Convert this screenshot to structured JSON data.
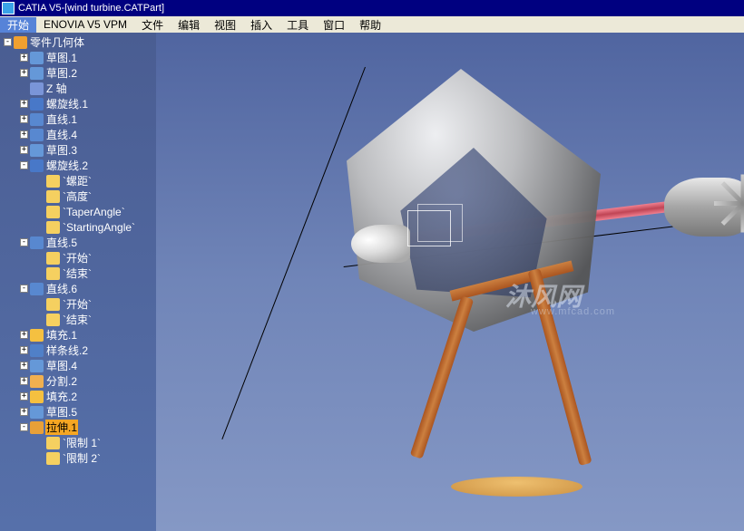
{
  "title": {
    "app": "CATIA V5",
    "sep": " - ",
    "doc": "[wind turbine.CATPart]"
  },
  "menu": {
    "items": [
      "开始",
      "ENOVIA V5 VPM",
      "文件",
      "编辑",
      "视图",
      "插入",
      "工具",
      "窗口",
      "帮助"
    ]
  },
  "tree": [
    {
      "d": 0,
      "exp": "-",
      "ico": "icon-body",
      "lbl": "零件几何体",
      "hl": false
    },
    {
      "d": 1,
      "exp": "+",
      "ico": "icon-sketch",
      "lbl": "草图.1",
      "hl": false
    },
    {
      "d": 1,
      "exp": "+",
      "ico": "icon-sketch",
      "lbl": "草图.2",
      "hl": false
    },
    {
      "d": 1,
      "exp": "",
      "ico": "icon-axis",
      "lbl": "Z 轴",
      "hl": false
    },
    {
      "d": 1,
      "exp": "+",
      "ico": "icon-helix",
      "lbl": "螺旋线.1",
      "hl": false
    },
    {
      "d": 1,
      "exp": "+",
      "ico": "icon-line",
      "lbl": "直线.1",
      "hl": false
    },
    {
      "d": 1,
      "exp": "+",
      "ico": "icon-line",
      "lbl": "直线.4",
      "hl": false
    },
    {
      "d": 1,
      "exp": "+",
      "ico": "icon-sketch",
      "lbl": "草图.3",
      "hl": false
    },
    {
      "d": 1,
      "exp": "-",
      "ico": "icon-helix",
      "lbl": "螺旋线.2",
      "hl": false
    },
    {
      "d": 2,
      "exp": "",
      "ico": "icon-param",
      "lbl": "`螺距`",
      "hl": false
    },
    {
      "d": 2,
      "exp": "",
      "ico": "icon-param",
      "lbl": "`高度`",
      "hl": false
    },
    {
      "d": 2,
      "exp": "",
      "ico": "icon-param",
      "lbl": "`TaperAngle`",
      "hl": false
    },
    {
      "d": 2,
      "exp": "",
      "ico": "icon-param",
      "lbl": "`StartingAngle`",
      "hl": false
    },
    {
      "d": 1,
      "exp": "-",
      "ico": "icon-line",
      "lbl": "直线.5",
      "hl": false
    },
    {
      "d": 2,
      "exp": "",
      "ico": "icon-param",
      "lbl": "`开始`",
      "hl": false
    },
    {
      "d": 2,
      "exp": "",
      "ico": "icon-param",
      "lbl": "`结束`",
      "hl": false
    },
    {
      "d": 1,
      "exp": "-",
      "ico": "icon-line",
      "lbl": "直线.6",
      "hl": false
    },
    {
      "d": 2,
      "exp": "",
      "ico": "icon-param",
      "lbl": "`开始`",
      "hl": false
    },
    {
      "d": 2,
      "exp": "",
      "ico": "icon-param",
      "lbl": "`结束`",
      "hl": false
    },
    {
      "d": 1,
      "exp": "+",
      "ico": "icon-fill",
      "lbl": "填充.1",
      "hl": false
    },
    {
      "d": 1,
      "exp": "+",
      "ico": "icon-spline",
      "lbl": "样条线.2",
      "hl": false
    },
    {
      "d": 1,
      "exp": "+",
      "ico": "icon-sketch",
      "lbl": "草图.4",
      "hl": false
    },
    {
      "d": 1,
      "exp": "+",
      "ico": "icon-split",
      "lbl": "分割.2",
      "hl": false
    },
    {
      "d": 1,
      "exp": "+",
      "ico": "icon-fill",
      "lbl": "填充.2",
      "hl": false
    },
    {
      "d": 1,
      "exp": "+",
      "ico": "icon-sketch",
      "lbl": "草图.5",
      "hl": false
    },
    {
      "d": 1,
      "exp": "-",
      "ico": "icon-extrude",
      "lbl": "拉伸.1",
      "hl": true
    },
    {
      "d": 2,
      "exp": "",
      "ico": "icon-param",
      "lbl": "`限制 1`",
      "hl": false
    },
    {
      "d": 2,
      "exp": "",
      "ico": "icon-param",
      "lbl": "`限制 2`",
      "hl": false
    }
  ],
  "watermark": {
    "text": "沐风网",
    "url": "www.mfcad.com"
  }
}
